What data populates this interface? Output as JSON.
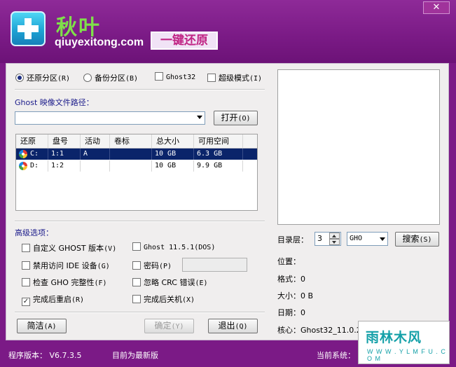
{
  "header": {
    "brand": "秋叶",
    "site": "qiuyexitong.com",
    "tagline": "一键还原",
    "close_label": "✕"
  },
  "mode": {
    "restore_label": "还原分区",
    "restore_key": "(R)",
    "backup_label": "备份分区",
    "backup_key": "(B)",
    "ghost32_label": "Ghost32",
    "super_label": "超级模式",
    "super_key": "(I)"
  },
  "path": {
    "label": "Ghost 映像文件路径：",
    "value": "",
    "open_label": "打开",
    "open_key": "(O)"
  },
  "table": {
    "headers": [
      "还原",
      "盘号",
      "活动",
      "卷标",
      "总大小",
      "可用空间"
    ],
    "rows": [
      {
        "drive": "C:",
        "num": "1:1",
        "active": "A",
        "label": "",
        "total": "10 GB",
        "free": "6.3 GB",
        "selected": true
      },
      {
        "drive": "D:",
        "num": "1:2",
        "active": "",
        "label": "",
        "total": "10 GB",
        "free": "9.9 GB",
        "selected": false
      }
    ]
  },
  "advanced": {
    "title": "高级选项：",
    "opt1": "自定义 GHOST 版本",
    "opt1_key": "(V)",
    "opt2": "禁用访问 IDE 设备",
    "opt2_key": "(G)",
    "opt3": "检查 GHO 完整性",
    "opt3_key": "(F)",
    "opt4": "完成后重启",
    "opt4_key": "(R)",
    "opt5": "Ghost 11.5.1(DOS)",
    "opt6": "密码",
    "opt6_key": "(P)",
    "opt7": "忽略 CRC 错误",
    "opt7_key": "(E)",
    "opt8": "完成后关机",
    "opt8_key": "(X)",
    "check_mark": "✓"
  },
  "buttons": {
    "simple": "简洁",
    "simple_key": "(A)",
    "ok": "确定",
    "ok_key": "(Y)",
    "exit": "退出",
    "exit_key": "(Q)"
  },
  "search": {
    "depth_label": "目录层：",
    "depth_value": "3",
    "type_value": "GHO",
    "search_label": "搜索",
    "search_key": "(S)"
  },
  "info": {
    "location": "位置：",
    "format": "格式：0",
    "size": "大小：0 B",
    "date": "日期：0",
    "core": "核心：Ghost32_11.0.2"
  },
  "status": {
    "version": "程序版本： V6.7.3.5",
    "latest": "目前为最新版",
    "current_system": "当前系统："
  },
  "watermark": {
    "main": "雨林木风",
    "sub": "W W W . Y L M F U . C O M"
  }
}
